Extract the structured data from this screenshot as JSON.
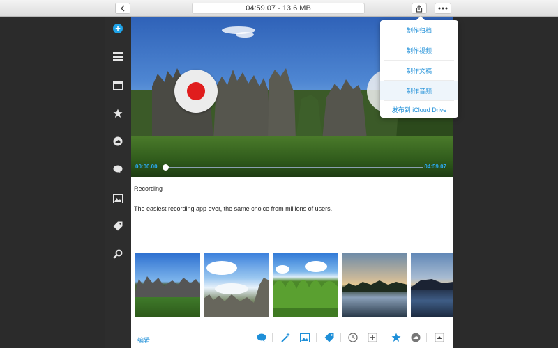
{
  "titlebar": {
    "title": "04:59.07 - 13.6 MB",
    "back_icon": "chevron-left-icon",
    "share_icon": "share-icon",
    "more_icon": "ellipsis-icon"
  },
  "sidebar": {
    "items": [
      {
        "name": "add",
        "icon": "add-circle-icon"
      },
      {
        "name": "notes",
        "icon": "list-icon"
      },
      {
        "name": "calendar",
        "icon": "calendar-icon"
      },
      {
        "name": "favorites",
        "icon": "star-icon"
      },
      {
        "name": "cloud",
        "icon": "cloud-icon"
      },
      {
        "name": "comments",
        "icon": "speech-bubble-icon"
      },
      {
        "name": "photos",
        "icon": "photo-icon"
      },
      {
        "name": "tags",
        "icon": "tag-icon"
      },
      {
        "name": "search",
        "icon": "search-icon"
      }
    ]
  },
  "player": {
    "elapsed": "00:00.00",
    "duration": "04:59.07",
    "progress": 0
  },
  "note": {
    "title": "Recording",
    "body": "The easiest recording app ever, the same choice from millions of users."
  },
  "menu": {
    "items": [
      {
        "label": "制作归档",
        "selected": false
      },
      {
        "label": "制作视频",
        "selected": false
      },
      {
        "label": "制作文稿",
        "selected": false
      },
      {
        "label": "制作音频",
        "selected": true
      },
      {
        "label": "发布到 iCloud Drive",
        "selected": false
      }
    ]
  },
  "toolbar": {
    "edit_label": "编辑",
    "tools": [
      "comment-icon",
      "magic-wand-icon",
      "image-icon",
      "tag-icon",
      "clock-icon",
      "add-box-icon",
      "star-icon",
      "cloud-icon",
      "collapse-icon"
    ]
  },
  "colors": {
    "accent": "#1e8fd8",
    "record": "#e01d1d",
    "sidebar_bg": "#2d2d2d"
  }
}
